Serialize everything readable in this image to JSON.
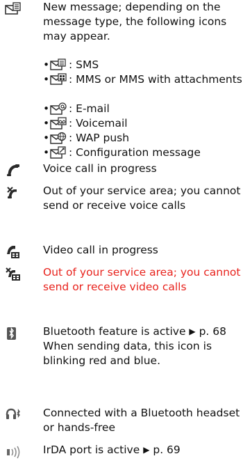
{
  "entries": [
    {
      "icon": "new-message-icon",
      "text": "New message; depending on the message type, the following icons may appear.",
      "sub_items": [
        {
          "icon": "sms-icon",
          "label": ": SMS"
        },
        {
          "icon": "mms-icon",
          "label": ": MMS or MMS with attachments"
        },
        {
          "icon": "email-icon",
          "label": ": E-mail"
        },
        {
          "icon": "voicemail-icon",
          "label": ": Voicemail"
        },
        {
          "icon": "wap-push-icon",
          "label": ": WAP push"
        },
        {
          "icon": "configuration-message-icon",
          "label": ": Configuration message"
        }
      ]
    },
    {
      "icon": "voice-call-icon",
      "text": "Voice call in progress"
    },
    {
      "icon": "no-voice-service-icon",
      "text": "Out of your service area; you cannot send or receive voice calls"
    },
    {
      "icon": "video-call-icon",
      "text": "Video call in progress"
    },
    {
      "icon": "no-video-service-icon",
      "text": "Out of your service area; you cannot send or receive video calls",
      "color": "#e8231d"
    },
    {
      "icon": "bluetooth-icon",
      "text_before": "Bluetooth feature is active ",
      "ref": "p. 68",
      "text_after": " When sending data, this icon is blinking red and blue."
    },
    {
      "icon": "bluetooth-headset-icon",
      "text": "Connected with a Bluetooth headset or hands-free"
    },
    {
      "icon": "irda-icon",
      "text_before": "IrDA port is active ",
      "ref": "p. 69"
    }
  ],
  "arrow_glyph": "▶",
  "bullet_glyph": "•"
}
